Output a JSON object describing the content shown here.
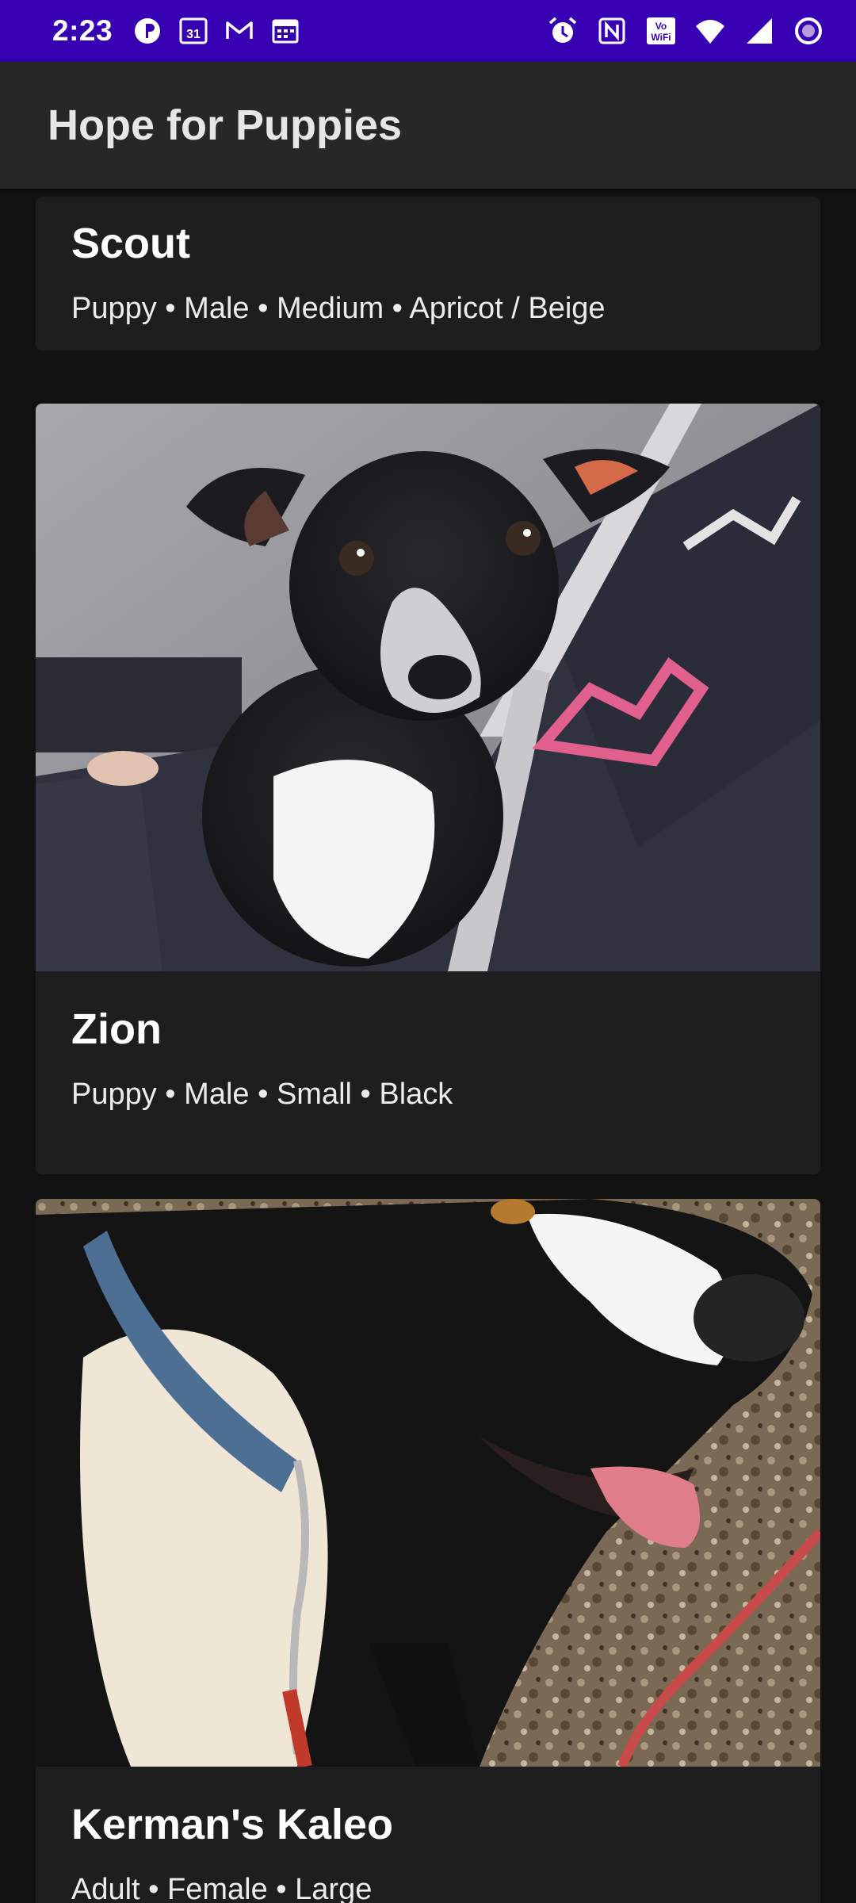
{
  "status_bar": {
    "time": "2:23",
    "left_icons": [
      "privacy-icon",
      "calendar-icon",
      "gmail-icon",
      "calendar-grid-icon"
    ],
    "calendar_day": "31",
    "right_icons": [
      "alarm-icon",
      "nfc-icon",
      "vowifi-icon",
      "wifi-icon",
      "signal-icon",
      "battery-ring-icon"
    ],
    "color": "#3700b3"
  },
  "app_bar": {
    "title": "Hope for Puppies"
  },
  "pets": [
    {
      "name": "Scout",
      "details": "Puppy • Male • Medium • Apricot / Beige"
    },
    {
      "name": "Zion",
      "details": "Puppy • Male • Small • Black"
    },
    {
      "name": "Kerman's Kaleo",
      "details": "Adult • Female • Large"
    }
  ]
}
